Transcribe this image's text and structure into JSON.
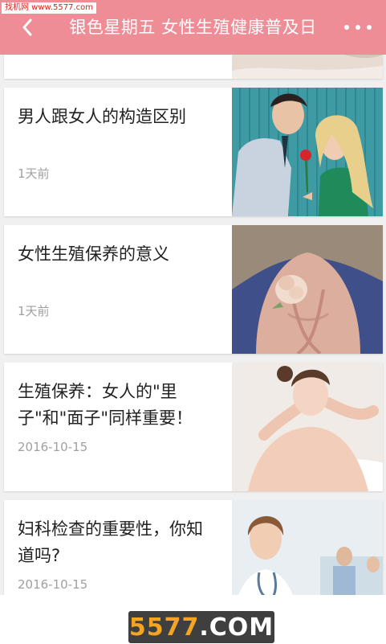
{
  "watermark_top": "找机网 www.5577.com",
  "header": {
    "title": "银色星期五 女性生殖健康普及日",
    "back_icon": "chevron-left-icon",
    "more_icon": "more-dots-icon",
    "background_color": "#ee8d96"
  },
  "articles": [
    {
      "title": "男人跟女人的构造区别",
      "date": "1天前",
      "image": "couple-flower-photo"
    },
    {
      "title": "女性生殖保养的意义",
      "date": "1天前",
      "image": "rose-body-photo"
    },
    {
      "title": "生殖保养：女人的\"里子\"和\"面子\"同样重要！",
      "date": "2016-10-15",
      "image": "bath-woman-photo"
    },
    {
      "title": "妇科检查的重要性，你知道吗?",
      "date": "2016-10-15",
      "image": "doctor-photo"
    }
  ],
  "footer_logo": {
    "number": "5577",
    "dot": ".",
    "domain": "COM"
  }
}
